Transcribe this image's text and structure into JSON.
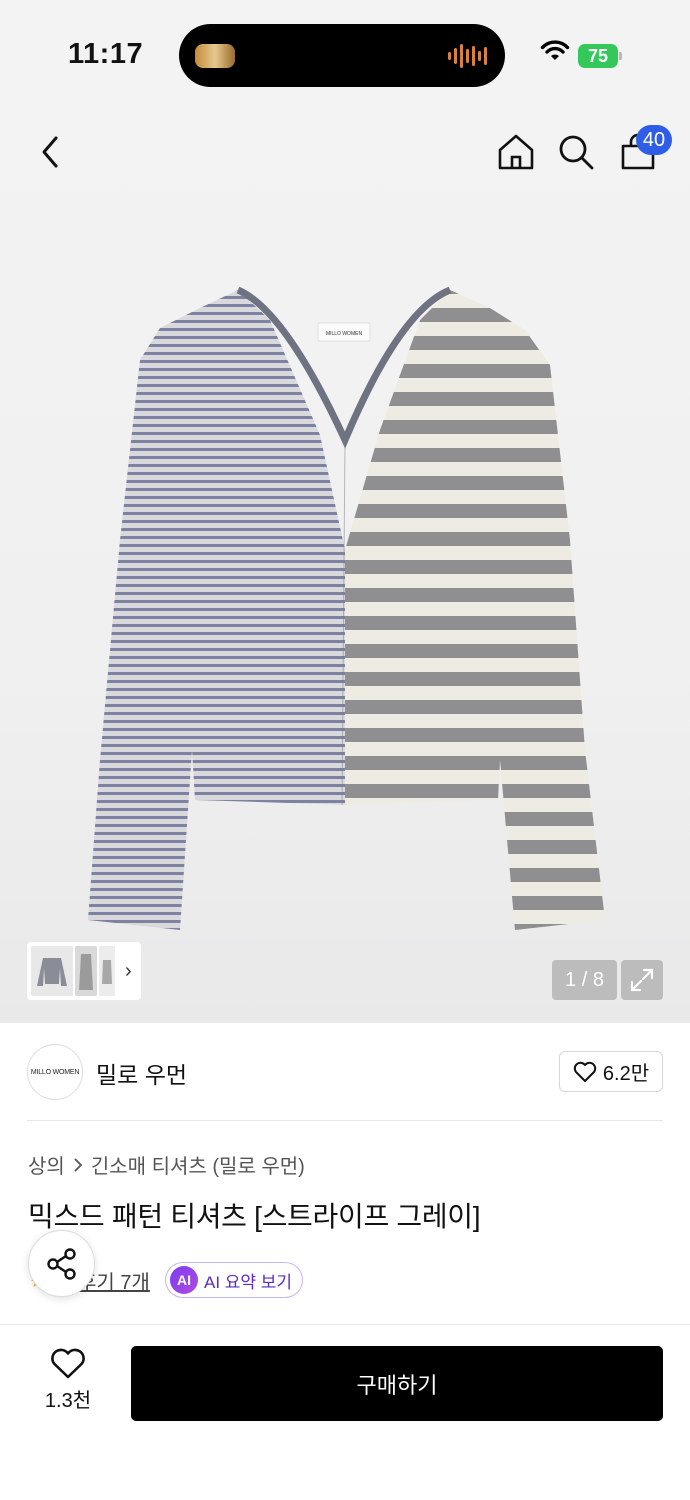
{
  "status_bar": {
    "time": "11:17",
    "battery": "75"
  },
  "header": {
    "cart_badge": "40"
  },
  "gallery": {
    "counter": "1 / 8",
    "garment_label": "MILLO WOMEN"
  },
  "brand": {
    "logo_text": "MILLO WOMEN",
    "name": "밀로 우먼",
    "likes": "6.2만"
  },
  "breadcrumb": {
    "category": "상의",
    "subcategory": "긴소매 티셔츠 (밀로 우먼)"
  },
  "product": {
    "title": "믹스드 패턴 티셔츠 [스트라이프 그레이]"
  },
  "review": {
    "label": "후기 7개"
  },
  "ai_summary": {
    "badge": "AI",
    "label": "AI 요약 보기"
  },
  "bottom": {
    "wish_count": "1.3천",
    "buy_label": "구매하기"
  },
  "colors": {
    "accent_blue": "#2f5de8",
    "ai_purple": "#5a2bc8",
    "battery_green": "#34c759",
    "buy_button": "#000000"
  },
  "icons": [
    "back-icon",
    "home-icon",
    "search-icon",
    "shopping-bag-icon",
    "expand-icon",
    "heart-icon",
    "share-icon",
    "wifi-icon",
    "battery-icon",
    "star-icon",
    "chevron-right-icon"
  ]
}
